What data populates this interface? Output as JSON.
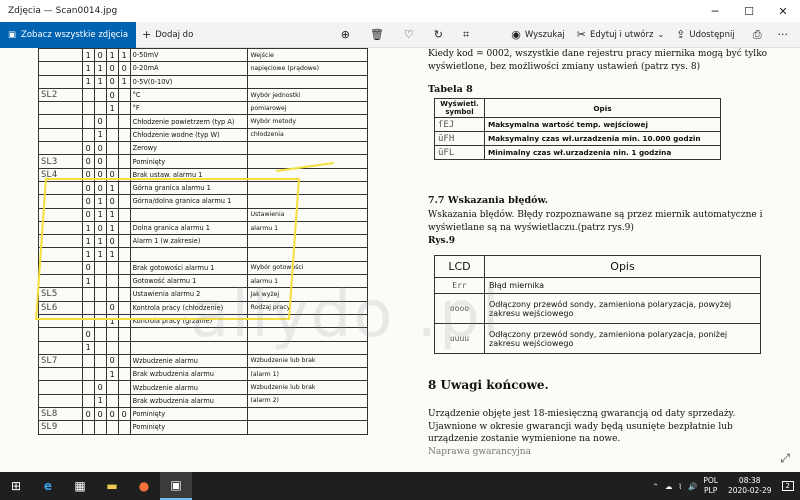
{
  "window": {
    "title": "Zdjęcia — Scan0014.jpg",
    "minimize_icon": "minimize-icon",
    "maximize_icon": "maximize-icon",
    "close_icon": "close-icon"
  },
  "toolbar": {
    "see_all": "Zobacz wszystkie zdjęcia",
    "add_to": "Dodaj do",
    "search": "Wyszukaj",
    "edit_create": "Edytuj i utwórz",
    "share": "Udostępnij"
  },
  "doc_left": {
    "rows": [
      {
        "code": "",
        "bits": [
          "1",
          "0",
          "1",
          "1"
        ],
        "desc": "0-50mV",
        "group": "Wejście"
      },
      {
        "code": "",
        "bits": [
          "1",
          "1",
          "0",
          "0"
        ],
        "desc": "0-20mA",
        "group": "napięciowe (prądowe)"
      },
      {
        "code": "",
        "bits": [
          "1",
          "1",
          "0",
          "1"
        ],
        "desc": "0-5V(0-10V)",
        "group": ""
      },
      {
        "code": "SL2",
        "bits": [
          "",
          "",
          "0",
          ""
        ],
        "desc": "°C",
        "group": "Wybór jednostki"
      },
      {
        "code": "",
        "bits": [
          "",
          "",
          "1",
          ""
        ],
        "desc": "°F",
        "group": "pomiarowej"
      },
      {
        "code": "",
        "bits": [
          "",
          "0",
          "",
          ""
        ],
        "desc": "Chłodzenie powietrzem (typ A)",
        "group": "Wybór metody"
      },
      {
        "code": "",
        "bits": [
          "",
          "1",
          "",
          ""
        ],
        "desc": "Chłodzenie wodne (typ W)",
        "group": "chłodzenia"
      },
      {
        "code": "",
        "bits": [
          "0",
          "0",
          "",
          ""
        ],
        "desc": "Zerowy",
        "group": ""
      },
      {
        "code": "SL3",
        "bits": [
          "0",
          "0",
          "",
          ""
        ],
        "desc": "Pominięty",
        "group": ""
      },
      {
        "code": "SL4",
        "bits": [
          "0",
          "0",
          "0",
          ""
        ],
        "desc": "Brak ustaw. alarmu 1",
        "group": ""
      },
      {
        "code": "",
        "bits": [
          "0",
          "0",
          "1",
          ""
        ],
        "desc": "Górna granica alarmu 1",
        "group": ""
      },
      {
        "code": "",
        "bits": [
          "0",
          "1",
          "0",
          ""
        ],
        "desc": "Górna/dolna granica alarmu 1",
        "group": ""
      },
      {
        "code": "",
        "bits": [
          "0",
          "1",
          "1",
          ""
        ],
        "desc": "",
        "group": "Ustawienia"
      },
      {
        "code": "",
        "bits": [
          "1",
          "0",
          "1",
          ""
        ],
        "desc": "Dolna granica alarmu 1",
        "group": "alarmu 1"
      },
      {
        "code": "",
        "bits": [
          "1",
          "1",
          "0",
          ""
        ],
        "desc": "Alarm 1 (w zakresie)",
        "group": ""
      },
      {
        "code": "",
        "bits": [
          "1",
          "1",
          "1",
          ""
        ],
        "desc": "",
        "group": ""
      },
      {
        "code": "",
        "bits": [
          "0",
          "",
          "",
          ""
        ],
        "desc": "Brak gotowości alarmu 1",
        "group": "Wybór gotowości"
      },
      {
        "code": "",
        "bits": [
          "1",
          "",
          "",
          ""
        ],
        "desc": "Gotowość alarmu 1",
        "group": "alarmu 1"
      },
      {
        "code": "SL5",
        "bits": [
          "",
          "",
          "",
          ""
        ],
        "desc": "Ustawienia alarmu 2",
        "group": "Jak wyżej"
      },
      {
        "code": "SL6",
        "bits": [
          "",
          "",
          "0",
          ""
        ],
        "desc": "Kontrola pracy (chłodzenie)",
        "group": "Rodzaj pracy"
      },
      {
        "code": "",
        "bits": [
          "",
          "",
          "1",
          ""
        ],
        "desc": "Kontrola pracy (grzanie)",
        "group": ""
      },
      {
        "code": "",
        "bits": [
          "0",
          "",
          "",
          ""
        ],
        "desc": "",
        "group": ""
      },
      {
        "code": "",
        "bits": [
          "1",
          "",
          "",
          ""
        ],
        "desc": "",
        "group": ""
      },
      {
        "code": "SL7",
        "bits": [
          "",
          "",
          "0",
          ""
        ],
        "desc": "Wzbudzenie alarmu",
        "group": "Wzbudzenie lub brak"
      },
      {
        "code": "",
        "bits": [
          "",
          "",
          "1",
          ""
        ],
        "desc": "Brak wzbudzenia alarmu",
        "group": "(alarm 1)"
      },
      {
        "code": "",
        "bits": [
          "",
          "0",
          "",
          ""
        ],
        "desc": "Wzbudzenie alarmu",
        "group": "Wzbudzenie lub brak"
      },
      {
        "code": "",
        "bits": [
          "",
          "1",
          "",
          ""
        ],
        "desc": "Brak wzbudzenia alarmu",
        "group": "(alarm 2)"
      },
      {
        "code": "SL8",
        "bits": [
          "0",
          "0",
          "0",
          "0"
        ],
        "desc": "Pominięty",
        "group": ""
      },
      {
        "code": "SL9",
        "bits": [
          "",
          "",
          "",
          ""
        ],
        "desc": "Pominięty",
        "group": ""
      }
    ]
  },
  "doc_right": {
    "intro": "Kiedy kod = 0002, wszystkie dane rejestru pracy miernika mogą być tylko wyświetlone, bez możliwości zmiany ustawień (patrz rys. 8)",
    "table8_title": "Tabela 8",
    "table8_head_symbol": "Wyświetl. symbol",
    "table8_head_desc": "Opis",
    "table8_rows": [
      {
        "symbol": "ſEJ",
        "desc": "Maksymalna wartość temp. wejściowej"
      },
      {
        "symbol": "ūFH",
        "desc": "Maksymalny czas wł.urzadzenia min. 10.000 godzin"
      },
      {
        "symbol": "ūFL",
        "desc": "Minimalny czas wł.urzadzenia nin. 1 godzina"
      }
    ],
    "section77_title": "7.7 Wskazania błędów.",
    "section77_text": "Wskazania błędów. Błędy rozpoznawane są przez miernik automatyczne i wyświetlane są na wyświetlaczu.(patrz rys.9)",
    "rys9": "Rys.9",
    "table9_head_lcd": "LCD",
    "table9_head_desc": "Opis",
    "table9_rows": [
      {
        "lcd": "Err",
        "desc": "Błąd miernika"
      },
      {
        "lcd": "oooo",
        "desc": "Odłączony przewód sondy, zamieniona polaryzacja, powyżej zakresu wejściowego"
      },
      {
        "lcd": "uuuu",
        "desc": "Odłączony przewód sondy, zamieniona polaryzacja, poniżej zakresu wejściowego"
      }
    ],
    "section8_title": "8 Uwagi końcowe.",
    "section8_text": "Urządzenie objęte jest 18-miesięczną gwarancją od daty sprzedaży. Ujawnione w okresie gwarancji wady będą usunięte bezpłatnie lub urządzenie zostanie wymienione na nowe.",
    "section8_cut": "Naprawa gwarancyjna"
  },
  "watermark": "allydo    .pl",
  "taskbar": {
    "lang_top": "POL",
    "lang_bottom": "PLP",
    "time": "08:38",
    "date": "2020-02-29",
    "notifications": "2"
  }
}
